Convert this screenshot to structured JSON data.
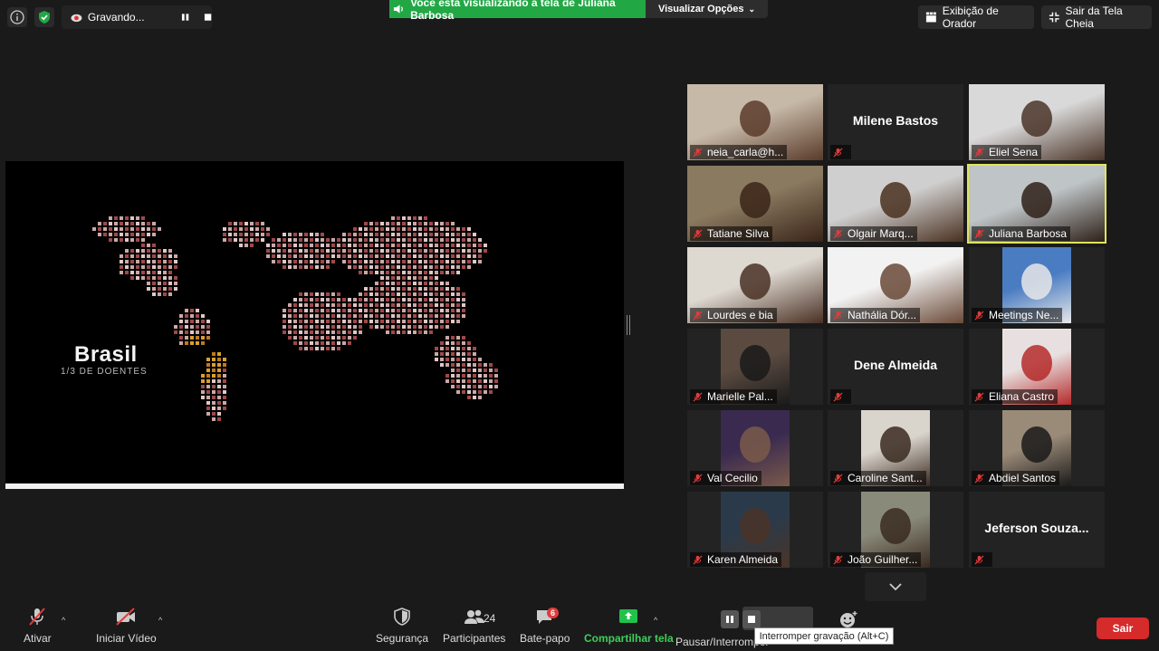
{
  "topbar": {
    "recording_label": "Gravando...",
    "share_banner": "Você está visualizando a tela de Juliana Barbosa",
    "view_options": "Visualizar Opções",
    "speaker_view": "Exibição de Orador",
    "exit_fullscreen": "Sair da Tela Cheia"
  },
  "slide": {
    "title": "Brasil",
    "subtitle": "1/3 DE DOENTES"
  },
  "participants": [
    {
      "name": "neia_carla@h...",
      "video": true
    },
    {
      "name": "Milene Bastos",
      "video": false
    },
    {
      "name": "Eliel Sena",
      "video": true
    },
    {
      "name": "Tatiane Silva",
      "video": true
    },
    {
      "name": "Olgair Marq...",
      "video": true
    },
    {
      "name": "Juliana Barbosa",
      "video": true,
      "active": true
    },
    {
      "name": "Lourdes e bia",
      "video": true
    },
    {
      "name": "Nathália Dór...",
      "video": true
    },
    {
      "name": "Meetings Ne...",
      "video": true
    },
    {
      "name": "Marielle Pal...",
      "video": true
    },
    {
      "name": "Dene Almeida",
      "video": false
    },
    {
      "name": "Eliana Castro",
      "video": true
    },
    {
      "name": "Val Cecilio",
      "video": true
    },
    {
      "name": "Caroline Sant...",
      "video": true
    },
    {
      "name": "Abdiel Santos",
      "video": true
    },
    {
      "name": "Karen Almeida",
      "video": true
    },
    {
      "name": "João Guilher...",
      "video": true
    },
    {
      "name": "Jeferson  Souza...",
      "video": false
    }
  ],
  "toolbar": {
    "unmute": "Ativar",
    "start_video": "Iniciar Vídeo",
    "security": "Segurança",
    "participants": "Participantes",
    "participants_count": "24",
    "chat": "Bate-papo",
    "chat_badge": "6",
    "share_screen": "Compartilhar tela",
    "pause_stop": "Pausar/Interromper",
    "stop_recording_tooltip": "Interromper gravação (Alt+C)",
    "leave": "Sair"
  },
  "colors": {
    "accent_green": "#22a745",
    "leave_red": "#d52b2b",
    "active_speaker": "#e0e45a"
  }
}
